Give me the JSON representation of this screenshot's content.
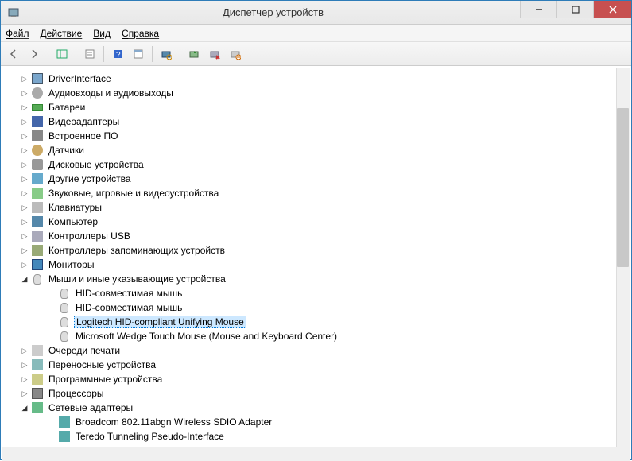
{
  "window": {
    "title": "Диспетчер устройств"
  },
  "menu": {
    "file": "Файл",
    "action": "Действие",
    "view": "Вид",
    "help": "Справка"
  },
  "tree": {
    "nodes": [
      {
        "label": "DriverInterface",
        "icon": "dev",
        "expand": "▷",
        "level": 1
      },
      {
        "label": "Аудиовходы и аудиовыходы",
        "icon": "audio",
        "expand": "▷",
        "level": 1
      },
      {
        "label": "Батареи",
        "icon": "battery",
        "expand": "▷",
        "level": 1
      },
      {
        "label": "Видеоадаптеры",
        "icon": "video",
        "expand": "▷",
        "level": 1
      },
      {
        "label": "Встроенное ПО",
        "icon": "firmware",
        "expand": "▷",
        "level": 1
      },
      {
        "label": "Датчики",
        "icon": "sensor",
        "expand": "▷",
        "level": 1
      },
      {
        "label": "Дисковые устройства",
        "icon": "disk",
        "expand": "▷",
        "level": 1
      },
      {
        "label": "Другие устройства",
        "icon": "other",
        "expand": "▷",
        "level": 1
      },
      {
        "label": "Звуковые, игровые и видеоустройства",
        "icon": "sound",
        "expand": "▷",
        "level": 1
      },
      {
        "label": "Клавиатуры",
        "icon": "keyboard",
        "expand": "▷",
        "level": 1
      },
      {
        "label": "Компьютер",
        "icon": "computer",
        "expand": "▷",
        "level": 1
      },
      {
        "label": "Контроллеры USB",
        "icon": "usb",
        "expand": "▷",
        "level": 1
      },
      {
        "label": "Контроллеры запоминающих устройств",
        "icon": "storage",
        "expand": "▷",
        "level": 1
      },
      {
        "label": "Мониторы",
        "icon": "monitor",
        "expand": "▷",
        "level": 1
      },
      {
        "label": "Мыши и иные указывающие устройства",
        "icon": "mouse",
        "expand": "◢",
        "level": 1
      },
      {
        "label": "HID-совместимая мышь",
        "icon": "mouse",
        "expand": "",
        "level": 2
      },
      {
        "label": "HID-совместимая мышь",
        "icon": "mouse",
        "expand": "",
        "level": 2
      },
      {
        "label": "Logitech HID-compliant Unifying Mouse",
        "icon": "mouse",
        "expand": "",
        "level": 2,
        "selected": true
      },
      {
        "label": "Microsoft Wedge Touch Mouse (Mouse and Keyboard Center)",
        "icon": "mouse",
        "expand": "",
        "level": 2
      },
      {
        "label": "Очереди печати",
        "icon": "print",
        "expand": "▷",
        "level": 1
      },
      {
        "label": "Переносные устройства",
        "icon": "portable",
        "expand": "▷",
        "level": 1
      },
      {
        "label": "Программные устройства",
        "icon": "soft",
        "expand": "▷",
        "level": 1
      },
      {
        "label": "Процессоры",
        "icon": "cpu",
        "expand": "▷",
        "level": 1
      },
      {
        "label": "Сетевые адаптеры",
        "icon": "net",
        "expand": "◢",
        "level": 1
      },
      {
        "label": "Broadcom 802.11abgn Wireless SDIO Adapter",
        "icon": "netadp",
        "expand": "",
        "level": 2
      },
      {
        "label": "Teredo Tunneling Pseudo-Interface",
        "icon": "netadp",
        "expand": "",
        "level": 2
      }
    ]
  }
}
